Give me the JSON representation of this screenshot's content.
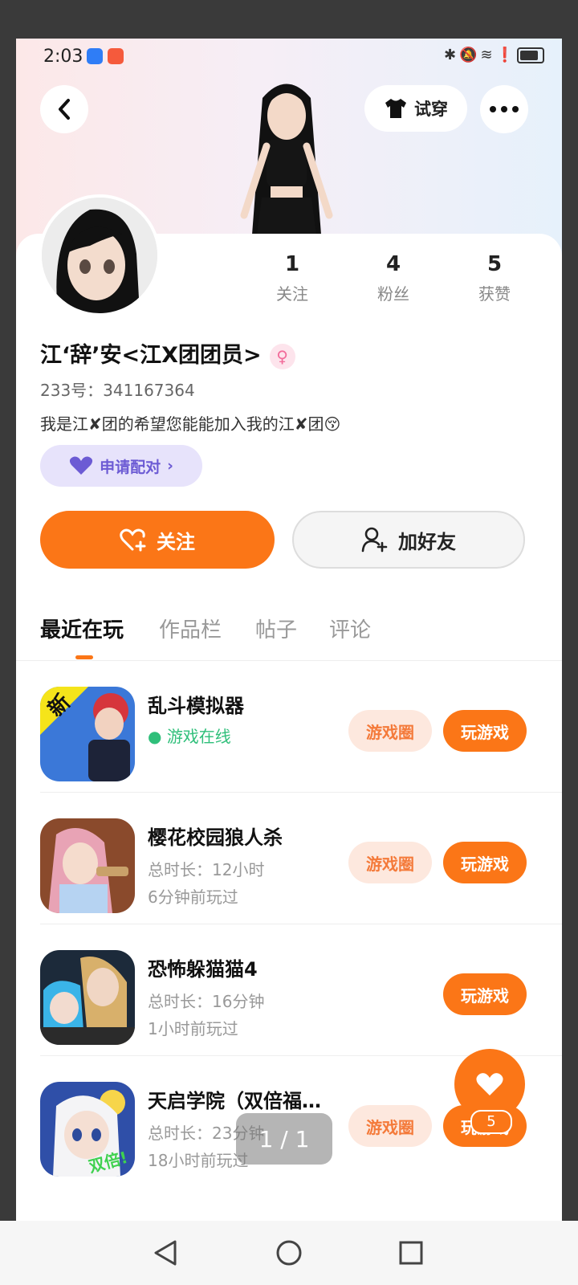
{
  "status_bar": {
    "time": "2:03"
  },
  "header": {
    "try_on_label": "试穿"
  },
  "stats": [
    {
      "value": "1",
      "label": "关注"
    },
    {
      "value": "4",
      "label": "粉丝"
    },
    {
      "value": "5",
      "label": "获赞"
    }
  ],
  "profile": {
    "name": "江‘辞’安<江X团团员>",
    "uid": "233号：341167364",
    "bio": "我是江✘团的希望您能能加入我的江✘团😚",
    "pair_label": "申请配对"
  },
  "actions": {
    "follow_label": "关注",
    "add_friend_label": "加好友"
  },
  "tabs": [
    "最近在玩",
    "作品栏",
    "帖子",
    "评论"
  ],
  "games": [
    {
      "title": "乱斗模拟器",
      "status": "游戏在线",
      "circle_label": "游戏圈",
      "play_label": "玩游戏"
    },
    {
      "title": "樱花校园狼人杀",
      "duration": "总时长：12小时",
      "last_played": "6分钟前玩过",
      "circle_label": "游戏圈",
      "play_label": "玩游戏"
    },
    {
      "title": "恐怖躲猫猫4",
      "duration": "总时长：16分钟",
      "last_played": "1小时前玩过",
      "play_label": "玩游戏"
    },
    {
      "title": "天启学院（双倍福…",
      "duration": "总时长：23分钟",
      "last_played": "18小时前玩过",
      "circle_label": "游戏圈",
      "play_label": "玩游戏",
      "icon_text": "双倍!"
    }
  ],
  "game_icon_badges": {
    "new_badge": "新"
  },
  "fab": {
    "count": "5"
  },
  "page_indicator": "1 / 1",
  "colors": {
    "accent": "#fb7617",
    "pair_bg": "#e7e3fb",
    "online": "#2fbf7a"
  }
}
